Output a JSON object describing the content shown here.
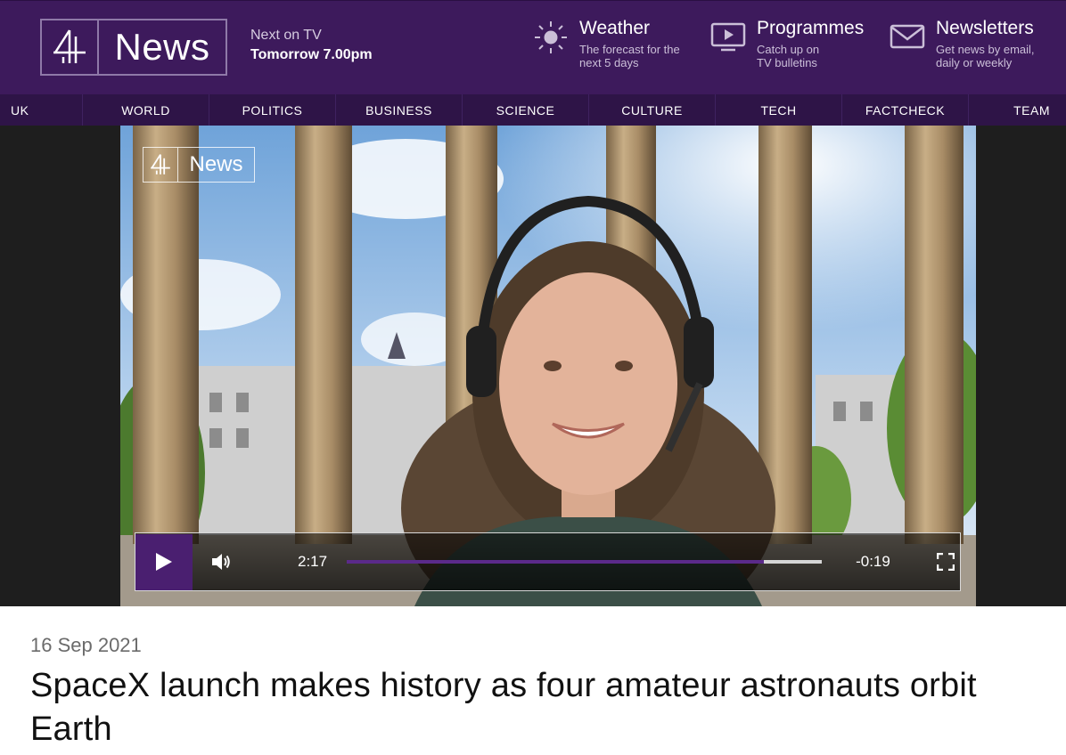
{
  "brand": {
    "logo_word": "News"
  },
  "next_on_tv": {
    "label": "Next on TV",
    "time": "Tomorrow 7.00pm"
  },
  "utilities": [
    {
      "icon": "sun-icon",
      "title": "Weather",
      "subtitle_1": "The forecast for the",
      "subtitle_2": "next 5 days"
    },
    {
      "icon": "play-screen-icon",
      "title": "Programmes",
      "subtitle_1": "Catch up on",
      "subtitle_2": "TV bulletins"
    },
    {
      "icon": "envelope-icon",
      "title": "Newsletters",
      "subtitle_1": "Get news by email,",
      "subtitle_2": "daily or weekly"
    }
  ],
  "nav": [
    "UK",
    "WORLD",
    "POLITICS",
    "BUSINESS",
    "SCIENCE",
    "CULTURE",
    "TECH",
    "FACTCHECK",
    "TEAM"
  ],
  "video": {
    "watermark_word": "News",
    "current_time": "2:17",
    "remaining_time": "-0:19",
    "progress": 0.878,
    "icons": [
      "play-icon",
      "volume-icon",
      "fullscreen-icon"
    ]
  },
  "article": {
    "date": "16 Sep 2021",
    "headline": "SpaceX launch makes history as four amateur astronauts orbit Earth"
  },
  "colors": {
    "header": "#3d1a5c",
    "nav": "#2e1447",
    "accent": "#5b2a8a"
  }
}
